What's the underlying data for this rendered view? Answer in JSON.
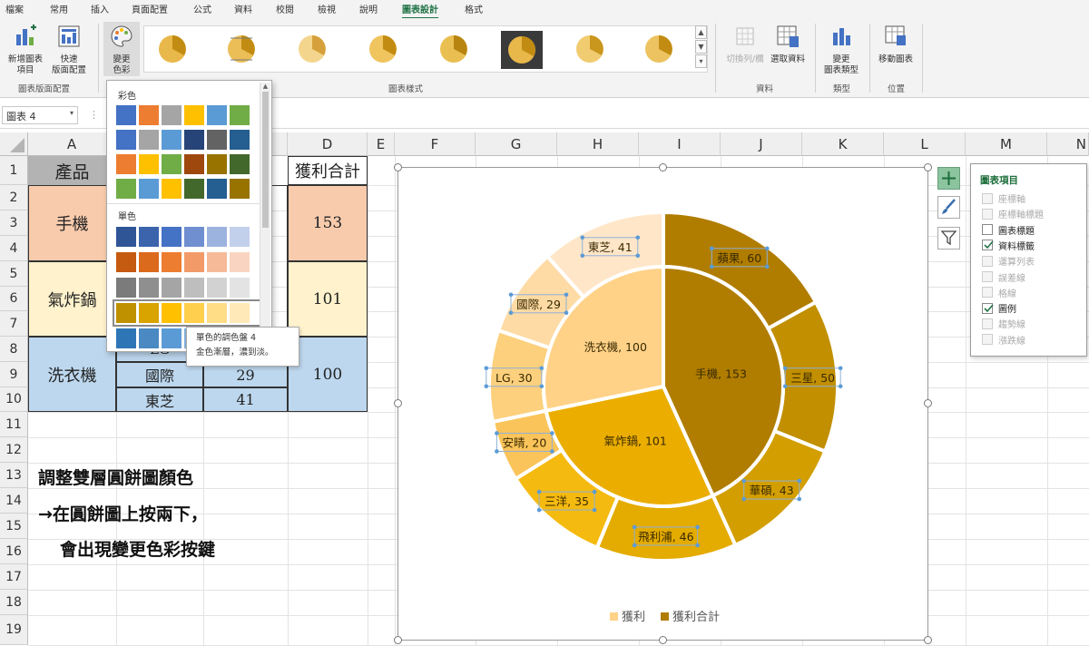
{
  "tabs": [
    "檔案",
    "常用",
    "插入",
    "頁面配置",
    "公式",
    "資料",
    "校閱",
    "檢視",
    "說明",
    "圖表設計",
    "格式"
  ],
  "active_tab": "圖表設計",
  "ribbon": {
    "add_element_l1": "新增圖表",
    "add_element_l2": "項目",
    "quick_layout_l1": "快速",
    "quick_layout_l2": "版面配置",
    "change_colors_l1": "變更",
    "change_colors_l2": "色彩",
    "group_layout": "圖表版面配置",
    "group_styles": "圖表樣式",
    "switch_rowcol": "切換列/欄",
    "select_data": "選取資料",
    "group_data": "資料",
    "change_type_l1": "變更",
    "change_type_l2": "圖表類型",
    "group_type": "類型",
    "move_chart": "移動圖表",
    "group_location": "位置"
  },
  "namebox": "圖表 4",
  "columns": [
    "A",
    "B",
    "C",
    "D",
    "E",
    "F",
    "G",
    "H",
    "I",
    "J",
    "K",
    "L",
    "M",
    "N"
  ],
  "rows": [
    "1",
    "2",
    "3",
    "4",
    "5",
    "6",
    "7",
    "8",
    "9",
    "10",
    "11",
    "12",
    "13",
    "14",
    "15",
    "16",
    "17",
    "18",
    "19"
  ],
  "table": {
    "header_product": "產品",
    "header_total": "獲利合計",
    "phone": "手機",
    "phone_total": "153",
    "fryer": "氣炸鍋",
    "fryer_total": "101",
    "washer": "洗衣機",
    "washer_total": "100",
    "r8b": "LG",
    "r9b": "國際",
    "r9c": "29",
    "r10b": "東芝",
    "r10c": "41"
  },
  "palette": {
    "colorful_title": "彩色",
    "mono_title": "單色",
    "tooltip_l1": "單色的調色盤 4",
    "tooltip_l2": "金色漸層，濃到淡。",
    "colorful_rows": [
      [
        "#4472C4",
        "#ED7D31",
        "#A5A5A5",
        "#FFC000",
        "#5B9BD5",
        "#70AD47"
      ],
      [
        "#4472C4",
        "#A5A5A5",
        "#5B9BD5",
        "#264478",
        "#636363",
        "#255E91"
      ],
      [
        "#ED7D31",
        "#FFC000",
        "#70AD47",
        "#9E480E",
        "#997300",
        "#43682B"
      ],
      [
        "#70AD47",
        "#5B9BD5",
        "#FFC000",
        "#43682B",
        "#255E91",
        "#997300"
      ]
    ],
    "mono_rows": [
      [
        "#2F5597",
        "#3B64AD",
        "#4472C4",
        "#6F8FD0",
        "#9DB3DF",
        "#C3D0EB"
      ],
      [
        "#C55A11",
        "#DB6A1C",
        "#ED7D31",
        "#F29B69",
        "#F6BA98",
        "#F9D5C1"
      ],
      [
        "#7B7B7B",
        "#8F8F8F",
        "#A5A5A5",
        "#BEBEBE",
        "#D2D2D2",
        "#E3E3E3"
      ],
      [
        "#BF9000",
        "#D9A300",
        "#FFC000",
        "#FFCF4D",
        "#FFDD86",
        "#FFE9B8"
      ],
      [
        "#2E75B6",
        "#4A89C2",
        "#5B9BD5",
        "#84B4E0",
        "#A9CAE9",
        "#CBDEF2"
      ]
    ]
  },
  "notes": {
    "line1": "調整雙層圓餅圖顏色",
    "line2": "→在圓餅圖上按兩下，",
    "line3": "會出現變更色彩按鍵"
  },
  "chart_data": {
    "type": "pie",
    "subtype": "doughnut-over-pie",
    "series": [
      {
        "name": "獲利合計",
        "labels": [
          "手機",
          "氣炸鍋",
          "洗衣機"
        ],
        "values": [
          153,
          101,
          100
        ]
      },
      {
        "name": "獲利",
        "labels": [
          "蘋果",
          "三星",
          "華碩",
          "飛利浦",
          "三洋",
          "安晴",
          "LG",
          "國際",
          "東芝"
        ],
        "values": [
          60,
          50,
          43,
          46,
          35,
          20,
          30,
          29,
          41
        ]
      }
    ],
    "inner_colors": [
      "#B07D00",
      "#EBAE00",
      "#FFD288"
    ],
    "outer_colors": [
      "#B07D00",
      "#C18F00",
      "#D39E00",
      "#E4AB00",
      "#F5BA10",
      "#FAC45A",
      "#FCD07D",
      "#FEDBA4",
      "#FFE6C8"
    ],
    "legend": {
      "position": "bottom",
      "entries": [
        "獲利",
        "獲利合計"
      ],
      "colors": [
        "#FFD288",
        "#B07D00"
      ]
    },
    "title": ""
  },
  "elements_pane": {
    "title": "圖表項目",
    "items": [
      {
        "label": "座標軸",
        "checked": false,
        "enabled": false
      },
      {
        "label": "座標軸標題",
        "checked": false,
        "enabled": false
      },
      {
        "label": "圖表標題",
        "checked": false,
        "enabled": true
      },
      {
        "label": "資料標籤",
        "checked": true,
        "enabled": true
      },
      {
        "label": "運算列表",
        "checked": false,
        "enabled": false
      },
      {
        "label": "誤差線",
        "checked": false,
        "enabled": false
      },
      {
        "label": "格線",
        "checked": false,
        "enabled": false
      },
      {
        "label": "圖例",
        "checked": true,
        "enabled": true
      },
      {
        "label": "趨勢線",
        "checked": false,
        "enabled": false
      },
      {
        "label": "漲跌線",
        "checked": false,
        "enabled": false
      }
    ]
  }
}
